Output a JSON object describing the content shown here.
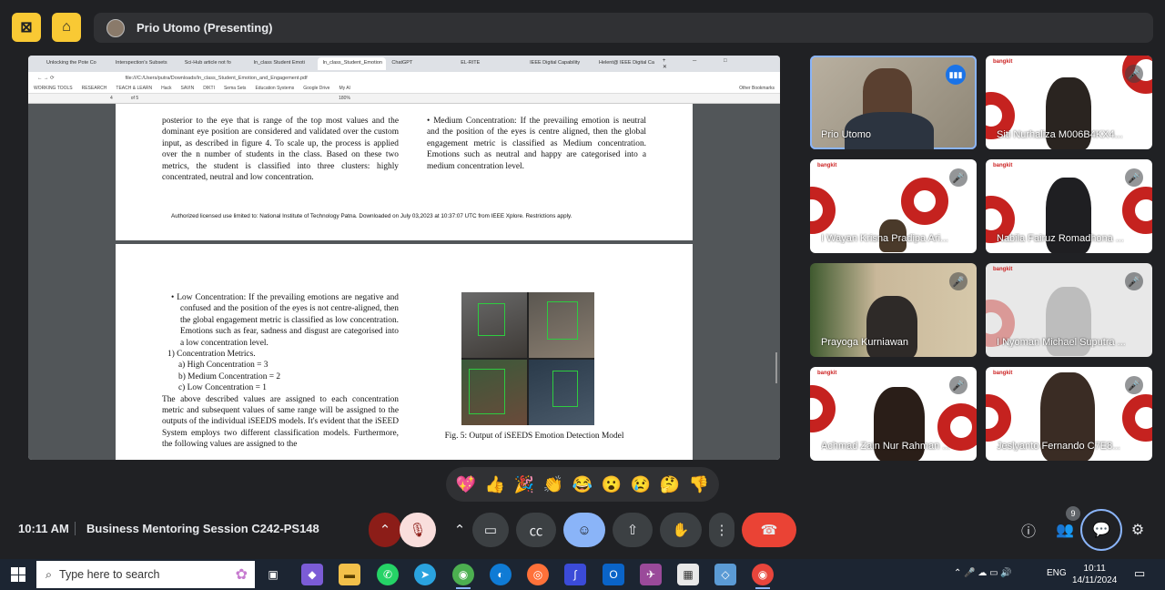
{
  "topbar": {
    "presenter": "Prio Utomo (Presenting)"
  },
  "browser": {
    "tabs": [
      "Unlocking the Pote Co",
      "Interspection's Subsets",
      "Sci-Hub article not fo",
      "In_class Student Emoti",
      "In_class_Student_Emotion",
      "ChatGPT",
      "EL-RITE",
      "IEEE Digital Capability",
      "Helent@ IEEE Digital Ca"
    ],
    "url": "file:///C:/Users/putra/Downloads/In_class_Student_Emotion_and_Engagement.pdf",
    "bookmarks": [
      "WORKING TOOLS",
      "RESEARCH",
      "TEACH & LEARN",
      "Hack",
      "SAVIN",
      "DIKTI",
      "Sema Sets",
      "Education Systems",
      "Google Drive",
      "My AI"
    ],
    "other_bookmarks": "Other Bookmarks",
    "page_indicator": "4",
    "page_total": "of 5",
    "zoom": "180%"
  },
  "pdf": {
    "page1_left": "posterior to the eye that is range of the top most values and the dominant eye position are considered and validated over the custom input, as described in figure 4. To scale up, the process is applied over the n number of students in the class. Based on these two metrics, the student is classified into three clusters: highly concentrated, neutral and low concentration.",
    "page1_right": "• Medium Concentration: If the prevailing emotion is neutral and the position of the eyes is centre aligned, then the global engagement metric is classified as Medium concentration. Emotions such as neutral and happy are categorised into a medium concentration level.",
    "footer": "Authorized licensed use limited to: National Institute of Technology Patna. Downloaded on July 03,2023 at 10:37:07 UTC from IEEE Xplore.  Restrictions apply.",
    "low_bullet": "• Low Concentration: If the prevailing emotions are negative and confused and the position of the eyes is not centre-aligned, then the global engagement metric is classified as low concentration. Emotions such as fear, sadness and disgust are categorised into a low concentration level.",
    "metrics_heading": "1)  Concentration Metrics.",
    "metric_a": "a)  High Concentration = 3",
    "metric_b": "b)  Medium Concentration = 2",
    "metric_c": "c)  Low Concentration = 1",
    "paragraph": "The above described values are assigned to each concentration metric and subsequent values of same range will be assigned to the outputs of the individual iSEEDS models. It's evident that the iSEED System employs two different classification models. Furthermore, the following values are assigned to the",
    "fig_caption": "Fig. 5: Output of iSEEDS Emotion Detection Model"
  },
  "participants": [
    {
      "name": "Prio Utomo",
      "speaking": true
    },
    {
      "name": "Siti Nurhaliza M006B4KX4...",
      "muted": true
    },
    {
      "name": "I Wayan Krisna Pradipa Ari...",
      "muted": true
    },
    {
      "name": "Nabila Fairuz Romadhona ...",
      "muted": true
    },
    {
      "name": "Prayoga Kurniawan",
      "muted": true
    },
    {
      "name": "I Nyoman Michael Suputra ...",
      "muted": true
    },
    {
      "name": "Achmad Zain Nur Rahman ...",
      "muted": true
    },
    {
      "name": "Jeslyanto Fernando C7E8...",
      "muted": true
    }
  ],
  "tile_logo": "bangkit",
  "reactions": [
    "💖",
    "👍",
    "🎉",
    "👏",
    "😂",
    "😮",
    "😢",
    "🤔",
    "👎"
  ],
  "bottom": {
    "time": "10:11 AM",
    "meeting_title": "Business Mentoring Session C242-PS148",
    "participant_count": "9"
  },
  "taskbar": {
    "search_placeholder": "Type here to search",
    "lang": "ENG",
    "clock_time": "10:11",
    "clock_date": "14/11/2024"
  },
  "colors": {
    "accent": "#8ab4f8",
    "end_call": "#ea4335",
    "host_button": "#f9c934"
  }
}
